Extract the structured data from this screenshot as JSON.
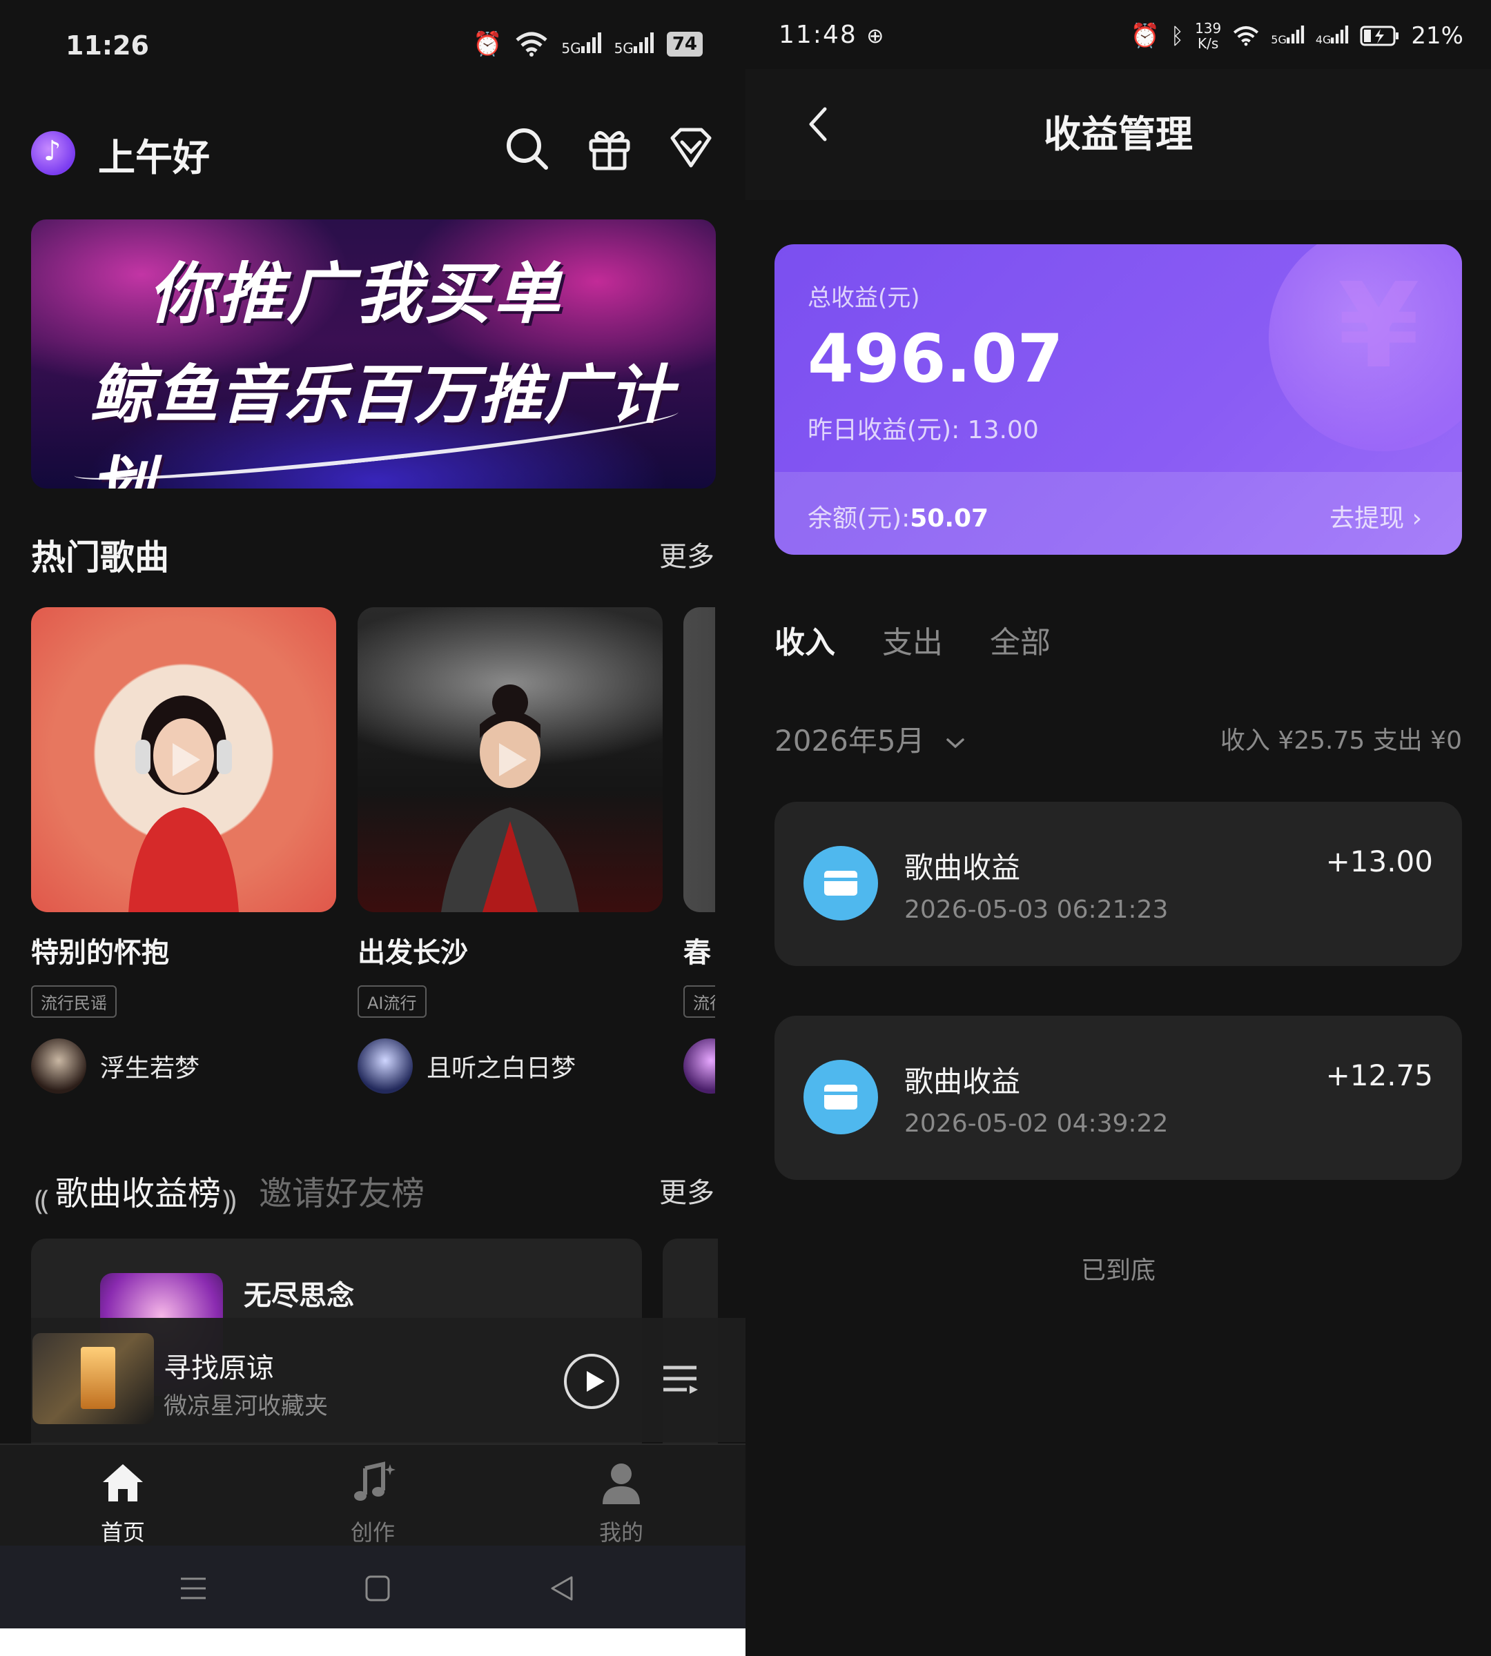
{
  "left_screen": {
    "status_bar": {
      "time": "11:26",
      "signal_1": "5G",
      "signal_2": "5G",
      "battery": "74"
    },
    "header": {
      "greeting": "上午好"
    },
    "banner": {
      "line1": "你推广我买单",
      "line2": "鲸鱼音乐百万推广计划"
    },
    "hot_songs": {
      "title": "热门歌曲",
      "more": "更多",
      "items": [
        {
          "name": "特别的怀抱",
          "tag": "流行民谣",
          "artist": "浮生若梦"
        },
        {
          "name": "出发长沙",
          "tag": "AI流行",
          "artist": "且听之白日梦"
        },
        {
          "name": "春",
          "tag": "流行",
          "artist": ""
        }
      ]
    },
    "ranking": {
      "tab_active": "歌曲收益榜",
      "tab_inactive": "邀请好友榜",
      "more": "更多",
      "first_item": {
        "title": "无尽思念"
      }
    },
    "mini_player": {
      "title": "寻找原谅",
      "subtitle": "微凉星河收藏夹"
    },
    "bottom_nav": [
      {
        "label": "首页",
        "active": true
      },
      {
        "label": "创作",
        "active": false
      },
      {
        "label": "我的",
        "active": false
      }
    ]
  },
  "right_screen": {
    "status_bar": {
      "time": "11:48",
      "speed_value": "139",
      "speed_unit": "K/s",
      "signal_1": "5G",
      "signal_2": "4G",
      "battery": "21%"
    },
    "header": {
      "title": "收益管理"
    },
    "earnings": {
      "total_label": "总收益(元)",
      "total_value": "496.07",
      "yesterday": "昨日收益(元): 13.00",
      "balance_label": "余额(元):",
      "balance_value": "50.07",
      "withdraw": "去提现 ›"
    },
    "tabs": [
      {
        "label": "收入",
        "active": true
      },
      {
        "label": "支出",
        "active": false
      },
      {
        "label": "全部",
        "active": false
      }
    ],
    "month": "2026年5月",
    "summary": "收入 ¥25.75 支出 ¥0",
    "transactions": [
      {
        "title": "歌曲收益",
        "time": "2026-05-03 06:21:23",
        "amount": "+13.00"
      },
      {
        "title": "歌曲收益",
        "time": "2026-05-02 04:39:22",
        "amount": "+12.75"
      }
    ],
    "end_text": "已到底"
  },
  "colors": {
    "background": "#131313",
    "card_purple": "#8a5cf4",
    "tx_icon_blue": "#4fb8ee",
    "muted_text": "#8a8a8a"
  }
}
